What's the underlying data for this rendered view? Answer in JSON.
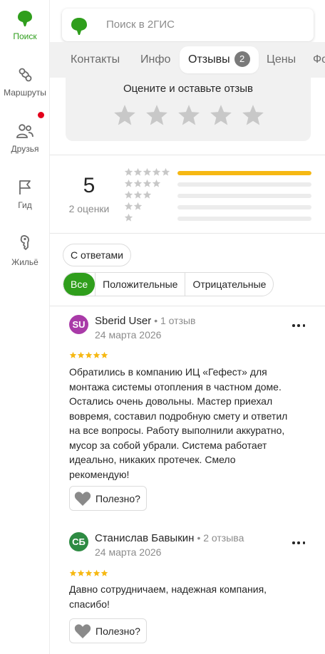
{
  "sidebar": {
    "items": [
      {
        "label": "Поиск",
        "icon": "leaf-pin-icon",
        "active": true
      },
      {
        "label": "Маршруты",
        "icon": "route-icon"
      },
      {
        "label": "Друзья",
        "icon": "friends-icon",
        "has_notification": true
      },
      {
        "label": "Гид",
        "icon": "flag-icon"
      },
      {
        "label": "Жильё",
        "icon": "key-icon"
      }
    ]
  },
  "search": {
    "placeholder": "Поиск в 2ГИС"
  },
  "tabs": [
    {
      "label": "Контакты"
    },
    {
      "label": "Инфо"
    },
    {
      "label": "Отзывы",
      "badge": "2",
      "active": true
    },
    {
      "label": "Цены"
    },
    {
      "label": "Фо"
    }
  ],
  "rate": {
    "title": "Оцените и оставьте отзыв",
    "stars": 5
  },
  "summary": {
    "average": "5",
    "count_label": "2 оценки",
    "distribution": [
      {
        "stars": 5,
        "fraction": 1.0
      },
      {
        "stars": 4,
        "fraction": 0.0
      },
      {
        "stars": 3,
        "fraction": 0.0
      },
      {
        "stars": 2,
        "fraction": 0.0
      },
      {
        "stars": 1,
        "fraction": 0.0
      }
    ]
  },
  "filters": {
    "with_replies": "С ответами",
    "segments": [
      {
        "label": "Все",
        "active": true
      },
      {
        "label": "Положительные"
      },
      {
        "label": "Отрицательные"
      }
    ]
  },
  "reviews": [
    {
      "initials": "SU",
      "avatar_color": "#a93aa8",
      "name": "Sberid User",
      "reviews_count": "1 отзыв",
      "date": "24 марта 2026",
      "rating": 5,
      "text": "Обратились в компанию ИЦ «Гефест» для монтажа системы отопления в частном доме. Остались очень довольны. Мастер приехал вовремя, составил подробную смету и ответил на все вопросы. Работу выполнили аккуратно, мусор за собой убрали. Система работает идеально, никаких протечек. Смело рекомендую!",
      "helpful_label": "Полезно?"
    },
    {
      "initials": "СБ",
      "avatar_color": "#2e8b43",
      "name": "Станислав Бавыкин",
      "reviews_count": "2 отзыва",
      "date": "24 марта 2026",
      "rating": 5,
      "text": "Давно сотрудничаем, надежная компания, спасибо!",
      "helpful_label": "Полезно?"
    }
  ],
  "colors": {
    "brand_green": "#2f9e1c",
    "star_gold": "#f6b813",
    "star_gray": "#c8c8c8",
    "notification_red": "#e3001b"
  }
}
